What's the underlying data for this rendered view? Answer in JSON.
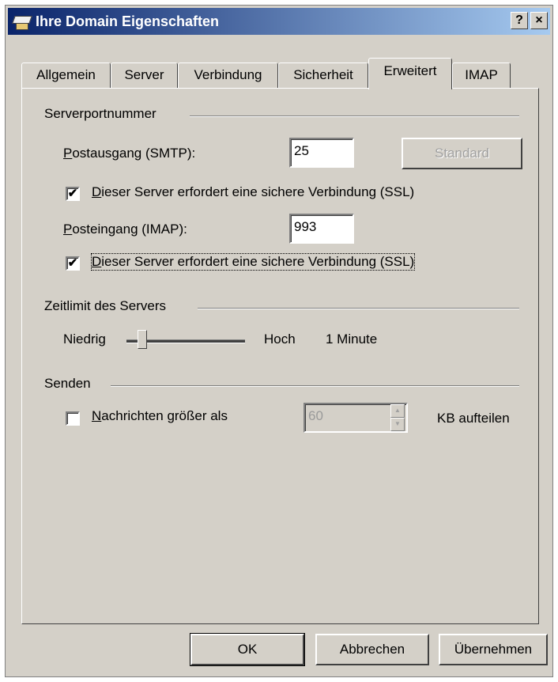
{
  "window": {
    "title": "Ihre Domain Eigenschaften",
    "help_label": "?",
    "close_label": "×"
  },
  "tabs": [
    {
      "label": "Allgemein",
      "active": false
    },
    {
      "label": "Server",
      "active": false
    },
    {
      "label": "Verbindung",
      "active": false
    },
    {
      "label": "Sicherheit",
      "active": false
    },
    {
      "label": "Erweitert",
      "active": true
    },
    {
      "label": "IMAP",
      "active": false
    }
  ],
  "ports": {
    "group_label": "Serverportnummer",
    "smtp_label": "Postausgang (SMTP):",
    "smtp_value": "25",
    "standard_button": "Standard",
    "smtp_ssl_label": "Dieser Server erfordert eine sichere Verbindung (SSL)",
    "smtp_ssl_checked": true,
    "imap_label": "Posteingang (IMAP):",
    "imap_value": "993",
    "imap_ssl_label": "Dieser Server erfordert eine sichere Verbindung (SSL)",
    "imap_ssl_checked": true
  },
  "timeout": {
    "group_label": "Zeitlimit des Servers",
    "low_label": "Niedrig",
    "high_label": "Hoch",
    "value_label": "1 Minute",
    "slider_level": 0.1
  },
  "sending": {
    "group_label": "Senden",
    "split_label": "Nachrichten größer als",
    "split_checked": false,
    "split_value": "60",
    "unit_label": "KB aufteilen"
  },
  "buttons": {
    "ok": "OK",
    "cancel": "Abbrechen",
    "apply": "Übernehmen"
  },
  "check_glyph": "✔",
  "colors": {
    "titlebar_start": "#0a246a",
    "titlebar_end": "#a6caf0",
    "face": "#d4d0c8"
  }
}
